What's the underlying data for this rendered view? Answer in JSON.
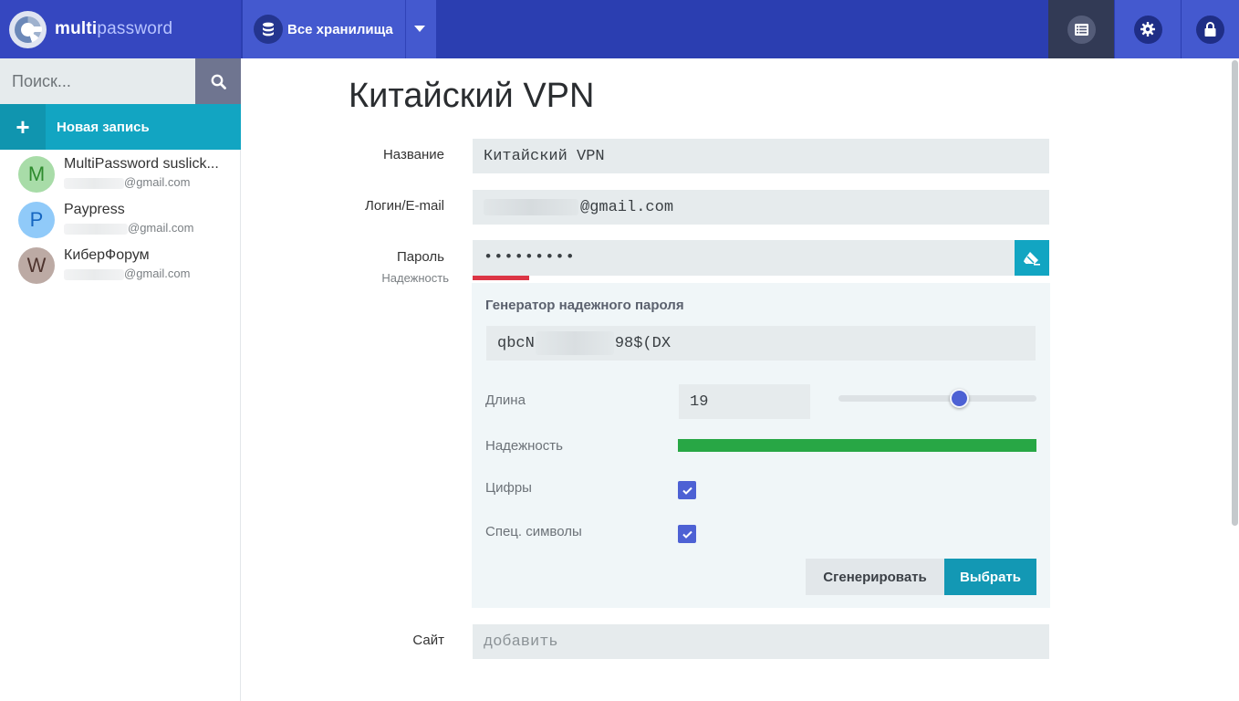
{
  "brand": {
    "name_bold": "multi",
    "name_light": "password"
  },
  "header": {
    "vault_label": "Все хранилища",
    "icons": [
      "database-icon",
      "caret-down-icon",
      "list-icon",
      "gear-icon",
      "lock-icon"
    ]
  },
  "sidebar": {
    "search_placeholder": "Поиск...",
    "new_entry_plus": "+",
    "new_entry_label": "Новая запись",
    "entries": [
      {
        "initial": "M",
        "title": "MultiPassword suslick...",
        "sub": "@gmail.com",
        "avatar_bg": "#a8dca8",
        "avatar_fg": "#2e8b2e"
      },
      {
        "initial": "P",
        "title": "Paypress",
        "sub": "@gmail.com",
        "avatar_bg": "#90caf9",
        "avatar_fg": "#1565c0"
      },
      {
        "initial": "W",
        "title": "КиберФорум",
        "sub": "@gmail.com",
        "avatar_bg": "#bcaaa4",
        "avatar_fg": "#4e342e"
      }
    ]
  },
  "entry": {
    "title": "Китайский VPN",
    "name_label": "Название",
    "name_value": "Китайский VPN",
    "login_label": "Логин/E-mail",
    "login_value_visible": "@gmail.com",
    "password_label": "Пароль",
    "password_strength_label": "Надежность",
    "password_value": "•••••••••",
    "password_strength": 0.1,
    "site_label": "Сайт",
    "site_placeholder": "добавить"
  },
  "generator": {
    "title": "Генератор надежного пароля",
    "output_start": "qbcN",
    "output_end": "98$(DX",
    "length_label": "Длина",
    "length_value": "19",
    "length_slider": 0.6,
    "strength_label": "Надежность",
    "strength_value": 1.0,
    "digits_label": "Цифры",
    "digits_checked": true,
    "symbols_label": "Спец. символы",
    "symbols_checked": true,
    "generate_button": "Сгенерировать",
    "select_button": "Выбрать"
  },
  "colors": {
    "topbar": "#2b3eb1",
    "accent": "#12a5c2",
    "primary": "#4d61d4",
    "strength_weak": "#dc3545",
    "strength_strong": "#28a745"
  }
}
